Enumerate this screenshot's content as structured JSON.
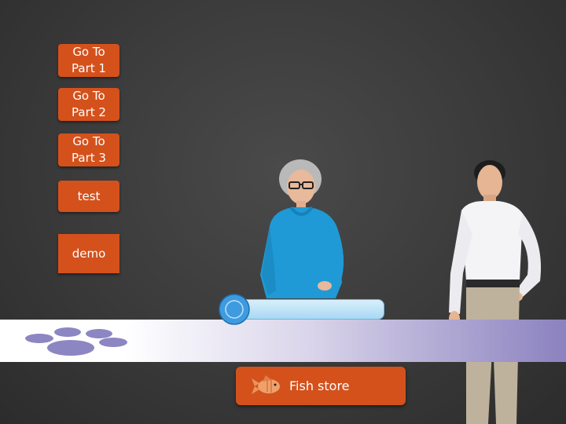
{
  "nav": {
    "part1": "Go To\nPart 1",
    "part2": "Go To\nPart 2",
    "part3": "Go To\nPart 3",
    "test": "test",
    "demo": "demo"
  },
  "fish_button": {
    "label": "Fish store",
    "icon": "fish-icon"
  },
  "slider": {
    "value": 0
  },
  "decorations": {
    "paw_icon": "paw-print-icon"
  },
  "colors": {
    "accent": "#d4511c",
    "band_end": "#8b82bf",
    "paw": "#8c86c2",
    "slider": "#3f9be0"
  }
}
